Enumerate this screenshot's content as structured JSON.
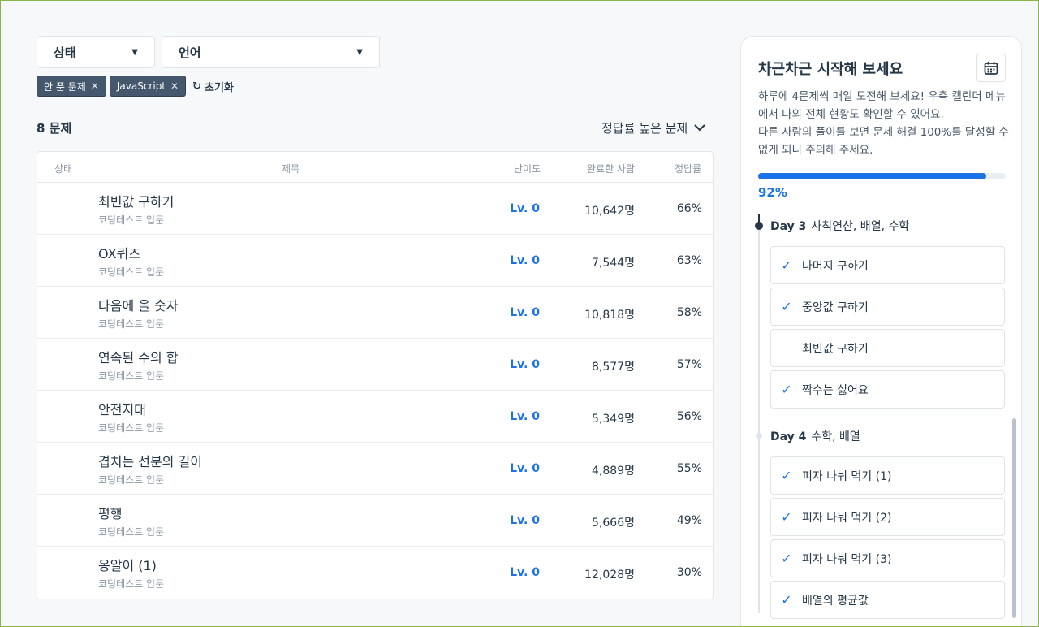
{
  "filters": {
    "status_label": "상태",
    "language_label": "언어",
    "chips": [
      "안 푼 문제",
      "JavaScript"
    ],
    "reset_label": "초기화"
  },
  "list": {
    "count_label": "8 문제",
    "sort_label": "정답률 높은 문제",
    "columns": {
      "status": "상태",
      "title": "제목",
      "level": "난이도",
      "completed": "완료한 사람",
      "rate": "정답률"
    },
    "rows": [
      {
        "title": "최빈값 구하기",
        "category": "코딩테스트 입문",
        "level": "Lv. 0",
        "completed": "10,642명",
        "rate": "66%"
      },
      {
        "title": "OX퀴즈",
        "category": "코딩테스트 입문",
        "level": "Lv. 0",
        "completed": "7,544명",
        "rate": "63%"
      },
      {
        "title": "다음에 올 숫자",
        "category": "코딩테스트 입문",
        "level": "Lv. 0",
        "completed": "10,818명",
        "rate": "58%"
      },
      {
        "title": "연속된 수의 합",
        "category": "코딩테스트 입문",
        "level": "Lv. 0",
        "completed": "8,577명",
        "rate": "57%"
      },
      {
        "title": "안전지대",
        "category": "코딩테스트 입문",
        "level": "Lv. 0",
        "completed": "5,349명",
        "rate": "56%"
      },
      {
        "title": "겹치는 선분의 길이",
        "category": "코딩테스트 입문",
        "level": "Lv. 0",
        "completed": "4,889명",
        "rate": "55%"
      },
      {
        "title": "평행",
        "category": "코딩테스트 입문",
        "level": "Lv. 0",
        "completed": "5,666명",
        "rate": "49%"
      },
      {
        "title": "옹알이 (1)",
        "category": "코딩테스트 입문",
        "level": "Lv. 0",
        "completed": "12,028명",
        "rate": "30%"
      }
    ]
  },
  "panel": {
    "title": "차근차근 시작해 보세요",
    "desc1": "하루에 4문제씩 매일 도전해 보세요! 우측 캘린더 메뉴에서 나의 전체 현황도 확인할 수 있어요.",
    "desc2": "다른 사람의 풀이를 보면 문제 해결 100%를 달성할 수 없게 되니 주의해 주세요.",
    "progress": 0.92,
    "progress_label": "92%",
    "days": [
      {
        "day": "Day 3",
        "topics": "사칙연산, 배열, 수학",
        "tasks": [
          {
            "name": "나머지 구하기",
            "done": true
          },
          {
            "name": "중앙값 구하기",
            "done": true
          },
          {
            "name": "최빈값 구하기",
            "done": false
          },
          {
            "name": "짝수는 싫어요",
            "done": true
          }
        ]
      },
      {
        "day": "Day 4",
        "topics": "수학, 배열",
        "tasks": [
          {
            "name": "피자 나눠 먹기 (1)",
            "done": true
          },
          {
            "name": "피자 나눠 먹기 (2)",
            "done": true
          },
          {
            "name": "피자 나눠 먹기 (3)",
            "done": true
          },
          {
            "name": "배열의 평균값",
            "done": true
          }
        ]
      }
    ]
  },
  "colors": {
    "accent": "#1b73e8",
    "chip": "#44576c",
    "text": "#263747"
  }
}
